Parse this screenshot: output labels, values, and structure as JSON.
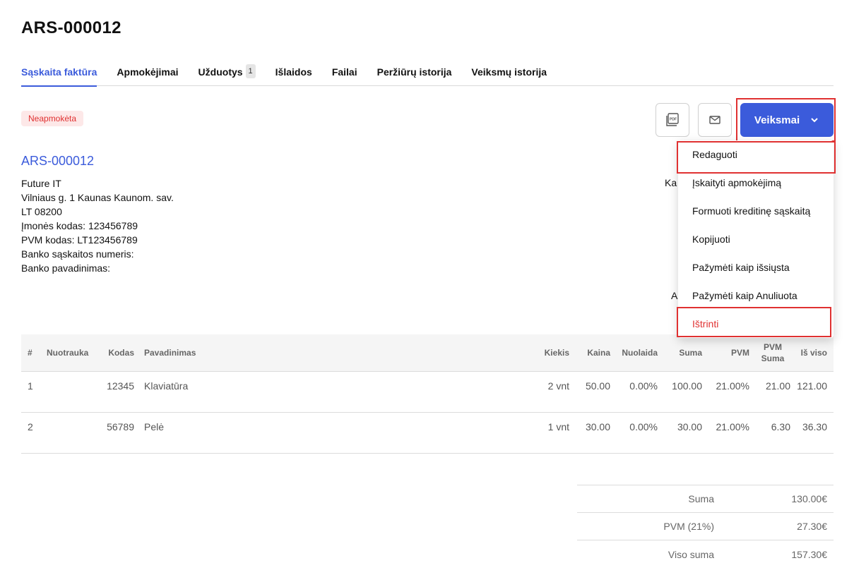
{
  "header": {
    "title": "ARS-000012"
  },
  "tabs": [
    {
      "label": "Sąskaita faktūra",
      "active": true
    },
    {
      "label": "Apmokėjimai"
    },
    {
      "label": "Užduotys",
      "count": "1"
    },
    {
      "label": "Išlaidos"
    },
    {
      "label": "Failai"
    },
    {
      "label": "Peržiūrų istorija"
    },
    {
      "label": "Veiksmų istorija"
    }
  ],
  "status": {
    "label": "Neapmokėta",
    "color": "#e03131"
  },
  "toolbar": {
    "pdf_icon": "pdf-icon",
    "mail_icon": "envelope-icon",
    "actions_label": "Veiksmai"
  },
  "actions_menu": {
    "items": [
      "Redaguoti",
      "Įskaityti apmokėjimą",
      "Formuoti kreditinę sąskaitą",
      "Kopijuoti",
      "Pažymėti kaip išsiųsta",
      "Pažymėti kaip Anuliuota",
      "Ištrinti"
    ]
  },
  "document": {
    "number": "ARS-000012",
    "seller_lines": [
      "Future IT",
      "Vilniaus g. 1 Kaunas Kaunom. sav.",
      "LT 08200",
      "Įmonės kodas: 123456789",
      "PVM kodas: LT123456789",
      "Banko sąskaitos numeris:",
      "Banko pavadinimas:"
    ],
    "partial_right_1": "Ka",
    "partial_right_2": "A"
  },
  "table": {
    "columns": [
      "#",
      "Nuotrauka",
      "Kodas",
      "Pavadinimas",
      "Kiekis",
      "Kaina",
      "Nuolaida",
      "Suma",
      "PVM",
      "PVM Suma",
      "Iš viso"
    ],
    "rows": [
      {
        "num": "1",
        "photo": "",
        "code": "12345",
        "name": "Klaviatūra",
        "qty": "2 vnt",
        "price": "50.00",
        "discount": "0.00%",
        "sum": "100.00",
        "vat": "21.00%",
        "vat_sum": "21.00",
        "total": "121.00"
      },
      {
        "num": "2",
        "photo": "",
        "code": "56789",
        "name": "Pelė",
        "qty": "1 vnt",
        "price": "30.00",
        "discount": "0.00%",
        "sum": "30.00",
        "vat": "21.00%",
        "vat_sum": "6.30",
        "total": "36.30"
      }
    ]
  },
  "totals": {
    "sum_label": "Suma",
    "sum_value": "130.00€",
    "vat_label": "PVM (21%)",
    "vat_value": "27.30€",
    "grand_label": "Viso suma",
    "grand_value": "157.30€"
  },
  "colors": {
    "accent": "#3b5bdb",
    "danger": "#e03131"
  }
}
